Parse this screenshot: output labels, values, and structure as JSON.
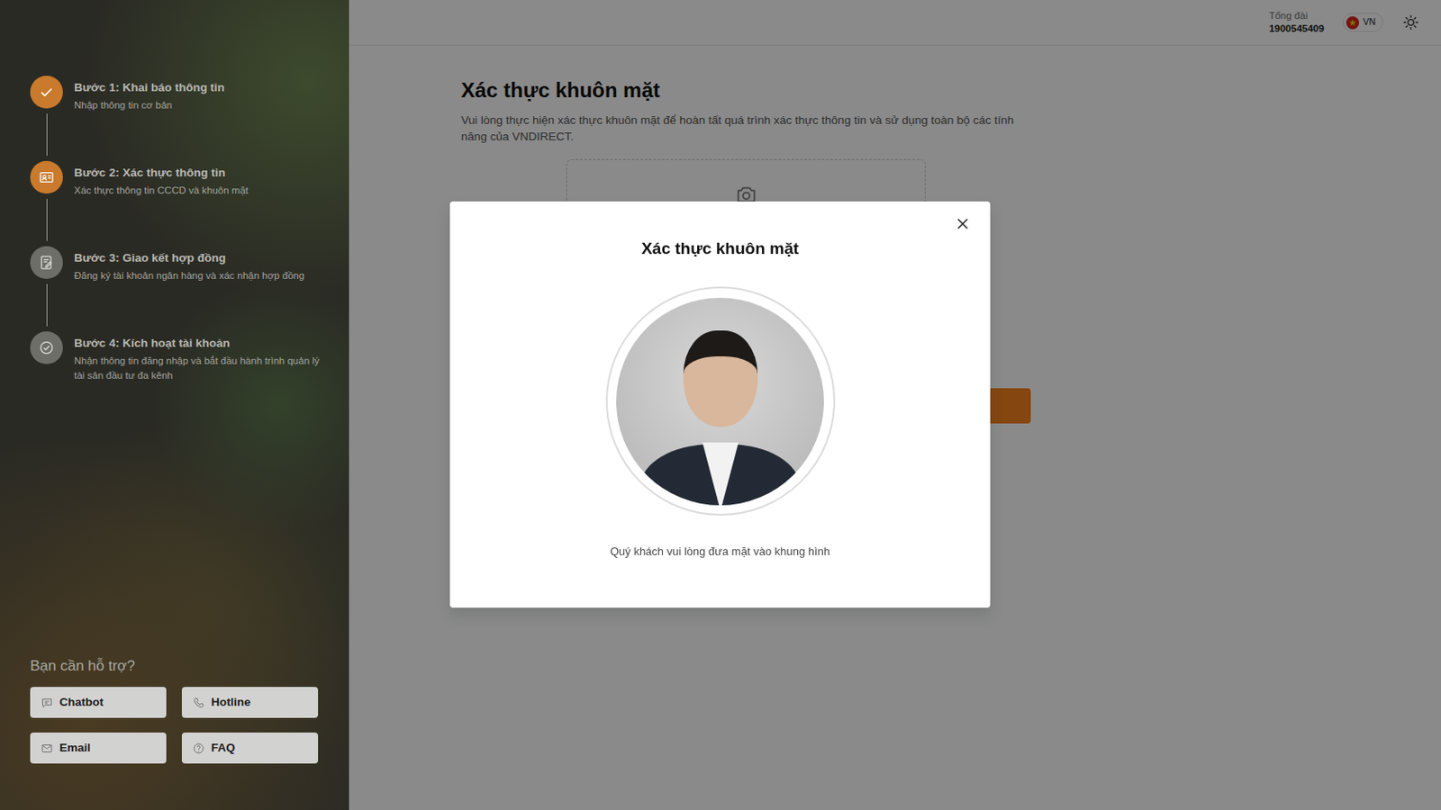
{
  "header": {
    "hotline_label": "Tổng đài",
    "hotline": "1900545409",
    "language": "VN"
  },
  "sidebar": {
    "steps": [
      {
        "title": "Bước 1: Khai báo thông tin",
        "subtitle": "Nhập thông tin cơ bản",
        "kind": "check",
        "completed": true,
        "selected": false
      },
      {
        "title": "Bước 2: Xác thực thông tin",
        "subtitle": "Xác thực thông tin CCCD và khuôn mặt",
        "kind": "id-card",
        "completed": false,
        "selected": true
      },
      {
        "title": "Bước 3: Giao kết hợp đồng",
        "subtitle": "Đăng ký tài khoản ngân hàng và xác nhận hợp đồng",
        "kind": "contract",
        "completed": false,
        "selected": false
      },
      {
        "title": "Bước 4: Kích hoạt tài khoản",
        "subtitle": "Nhận thông tin đăng nhập và bắt đầu hành trình quản lý tài sản đầu tư đa kênh",
        "kind": "activate",
        "completed": false,
        "selected": false
      }
    ],
    "help": {
      "title": "Bạn cần hỗ trợ?",
      "buttons": [
        {
          "label": "Chatbot",
          "kind": "chat"
        },
        {
          "label": "Hotline",
          "kind": "phone"
        },
        {
          "label": "Email",
          "kind": "mail"
        },
        {
          "label": "FAQ",
          "kind": "faq"
        }
      ]
    }
  },
  "page": {
    "title": "Xác thực khuôn mặt",
    "description": "Vui lòng thực hiện xác thực khuôn mặt để hoàn tất quá trình xác thực thông tin và sử dụng toàn bộ các tính năng của VNDIRECT."
  },
  "modal": {
    "title": "Xác thực khuôn mặt",
    "instruction": "Quý khách vui lòng đưa mặt vào khung hình"
  }
}
